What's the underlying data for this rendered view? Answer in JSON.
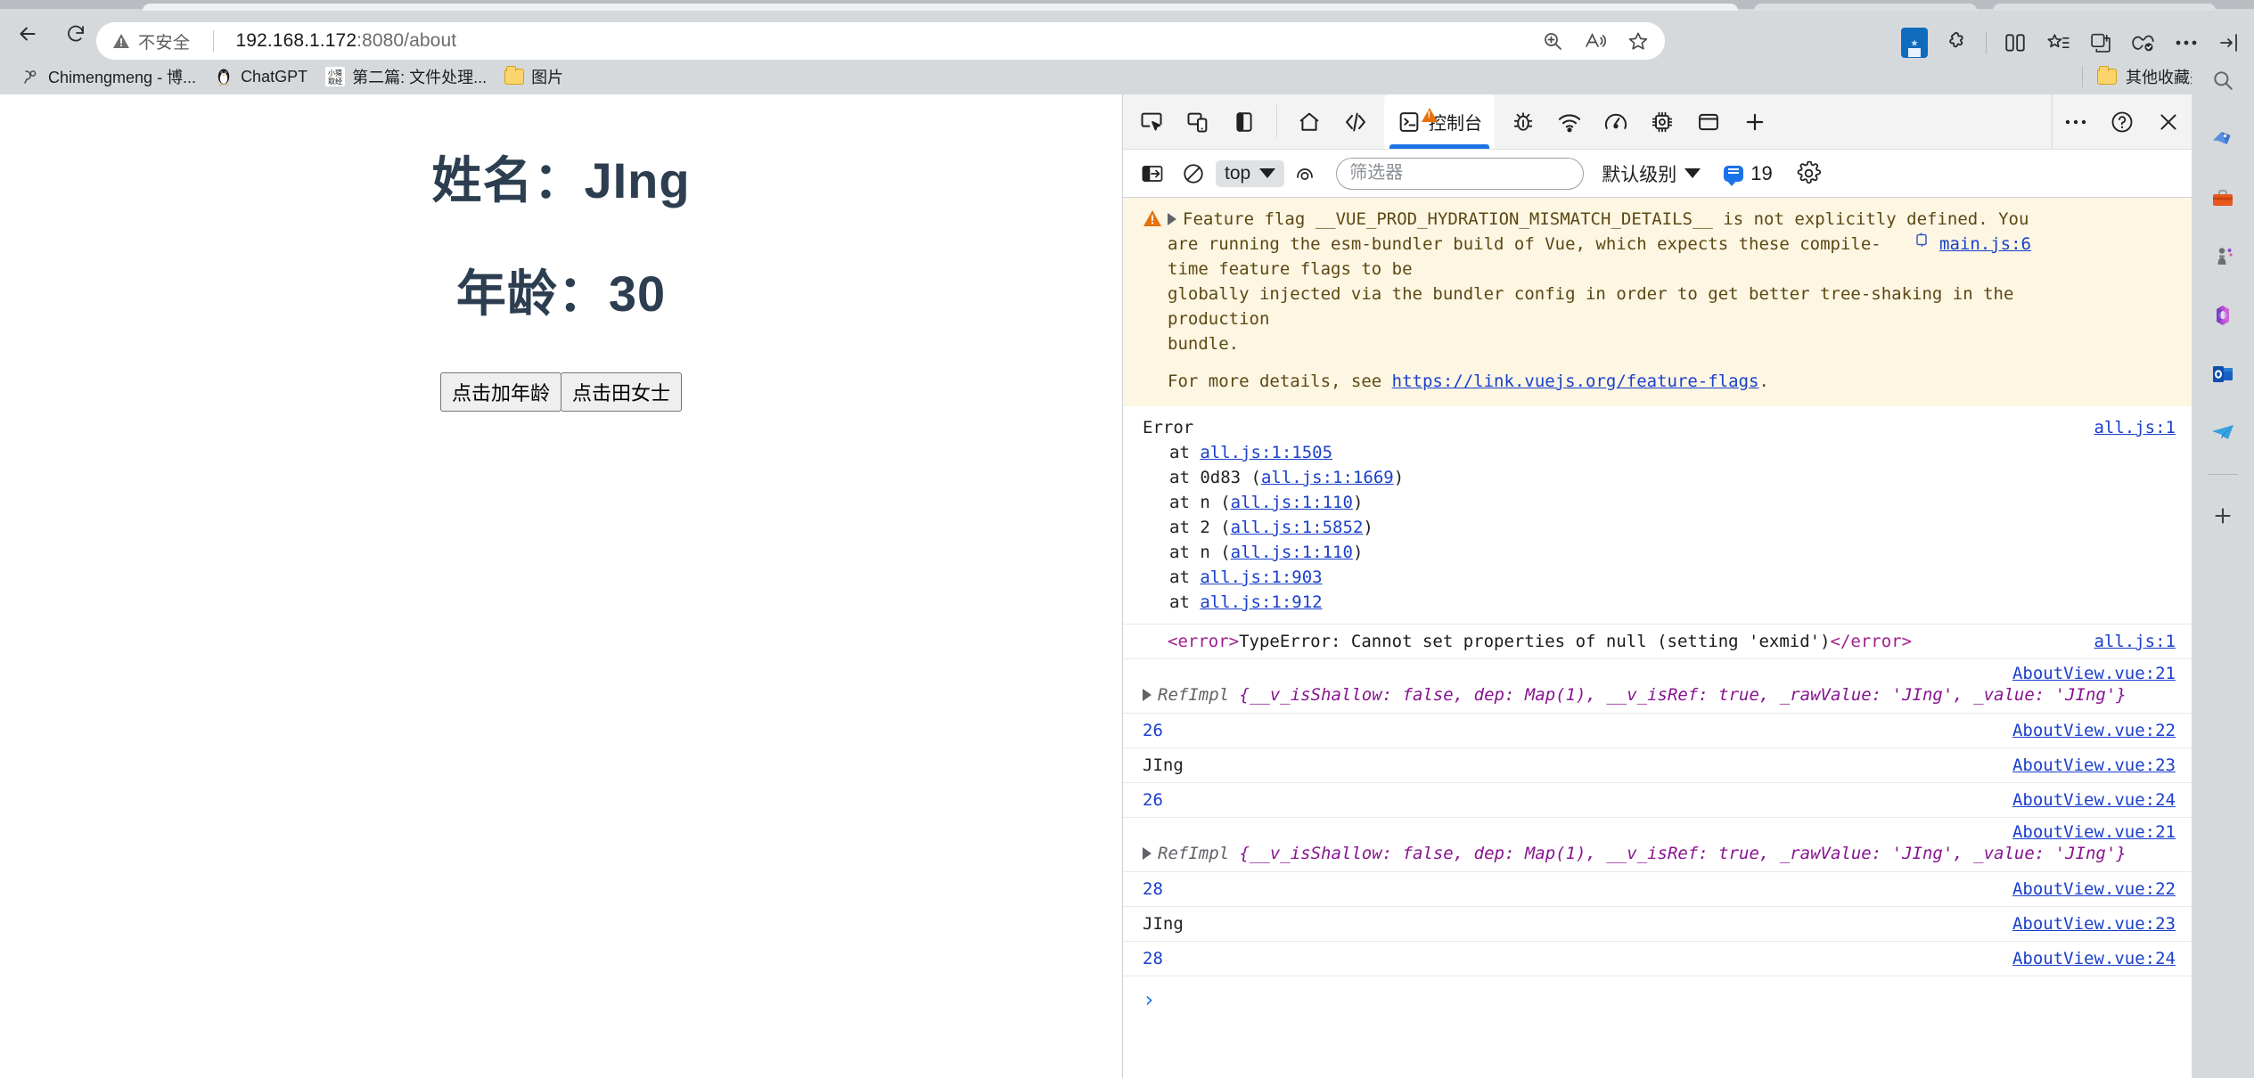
{
  "browser": {
    "nav": {
      "back_label": "Back",
      "refresh_label": "Refresh"
    },
    "omnibox": {
      "security_label": "不安全",
      "url_host": "192.168.1.172",
      "url_port_path": ":8080/about",
      "actions": [
        "zoom-icon",
        "read-aloud-icon",
        "favorite-icon"
      ]
    },
    "toolbar_right": [
      "collections-chip-icon",
      "extensions-icon",
      "split-screen-icon",
      "favorites-list-icon",
      "copilot-icon",
      "performance-icon",
      "more-icon",
      "sidebar-toggle-icon"
    ],
    "bookmarks": [
      {
        "label": "Chimengmeng - 博...",
        "icon": "cnblogs-icon"
      },
      {
        "label": "ChatGPT",
        "icon": "penguin-icon"
      },
      {
        "label": "第二篇: 文件处理...",
        "icon": "xiaoyuanquqing-icon"
      },
      {
        "label": "图片",
        "icon": "folder-icon"
      }
    ],
    "bookmarks_right": {
      "label": "其他收藏夹",
      "icon": "folder-icon"
    }
  },
  "page": {
    "name_line": "姓名：JIng",
    "age_line": "年龄：30",
    "buttons": [
      {
        "label": "点击加年龄"
      },
      {
        "label": "点击田女士"
      }
    ]
  },
  "devtools": {
    "tabs_left": [
      "inspect-element-icon",
      "device-toolbar-icon",
      "dock-side-icon"
    ],
    "panels": [
      "home-icon",
      "elements-icon"
    ],
    "active_tab": {
      "label": "控制台",
      "icon": "console-icon",
      "has_warning": true
    },
    "tabs_right": [
      "sources-icon",
      "network-icon",
      "performance-icon",
      "memory-icon",
      "application-icon",
      "more-panels-icon"
    ],
    "window_controls": [
      "more-options-icon",
      "help-icon",
      "close-icon"
    ],
    "filterbar": {
      "sidebar_toggle_icon": "console-sidebar-icon",
      "clear_icon": "clear-console-icon",
      "context": "top",
      "eye_icon": "live-expression-icon",
      "filter_placeholder": "筛选器",
      "filter_value": "",
      "level": "默认级别",
      "message_count": "19",
      "settings_icon": "gear-icon"
    },
    "console": {
      "warning": {
        "text_1": "Feature flag __VUE_PROD_HYDRATION_MISMATCH_DETAILS__ is not explicitly defined. You",
        "text_2": "are running the esm-bundler build of Vue, which expects these compile-time feature flags to be",
        "text_3": "globally injected via the bundler config in order to get better tree-shaking in the production",
        "text_4": "bundle.",
        "source": "main.js:6",
        "detail_prefix": "For more details, see",
        "detail_link": "https://link.vuejs.org/feature-flags",
        "detail_suffix": "."
      },
      "error_block": {
        "title": "Error",
        "source": "all.js:1",
        "frames": [
          {
            "prefix": "    at ",
            "fn": "",
            "link": "all.js:1:1505",
            "paren": false
          },
          {
            "prefix": "    at ",
            "fn": "0d83 ",
            "link": "all.js:1:1669",
            "paren": true
          },
          {
            "prefix": "    at ",
            "fn": "n ",
            "link": "all.js:1:110",
            "paren": true
          },
          {
            "prefix": "    at ",
            "fn": "2 ",
            "link": "all.js:1:5852",
            "paren": true
          },
          {
            "prefix": "    at ",
            "fn": "n ",
            "link": "all.js:1:110",
            "paren": true
          },
          {
            "prefix": "    at ",
            "fn": "",
            "link": "all.js:1:903",
            "paren": false
          },
          {
            "prefix": "    at ",
            "fn": "",
            "link": "all.js:1:912",
            "paren": false
          }
        ]
      },
      "type_error": {
        "open_tag": "<error>",
        "message": "TypeError: Cannot set properties of null (setting 'exmid')",
        "close_tag": "</error>",
        "source": "all.js:1"
      },
      "entries": [
        {
          "kind": "object",
          "class_name": "RefImpl",
          "body": "{__v_isShallow: false, dep: Map(1), __v_isRef: true, _rawValue: 'JIng', _value: 'JIng'}",
          "source": "AboutView.vue:21"
        },
        {
          "kind": "number",
          "value": "26",
          "source": "AboutView.vue:22"
        },
        {
          "kind": "string",
          "value": "JIng",
          "source": "AboutView.vue:23"
        },
        {
          "kind": "number",
          "value": "26",
          "source": "AboutView.vue:24"
        },
        {
          "kind": "object",
          "class_name": "RefImpl",
          "body": "{__v_isShallow: false, dep: Map(1), __v_isRef: true, _rawValue: 'JIng', _value: 'JIng'}",
          "source": "AboutView.vue:21"
        },
        {
          "kind": "number",
          "value": "28",
          "source": "AboutView.vue:22"
        },
        {
          "kind": "string",
          "value": "JIng",
          "source": "AboutView.vue:23"
        },
        {
          "kind": "number",
          "value": "28",
          "source": "AboutView.vue:24"
        }
      ],
      "prompt_symbol": "›"
    }
  },
  "sidebar": {
    "items": [
      "search-icon",
      "shopping-tag-icon",
      "tools-icon",
      "games-icon",
      "office-icon",
      "outlook-icon",
      "telegram-icon"
    ],
    "add_label": "+"
  },
  "colors": {
    "accent": "#1a73e8",
    "warning_bg": "#fdf6e3",
    "warning_icon": "#e8710a",
    "link": "#1a3fcb",
    "page_text": "#2c3e50"
  }
}
